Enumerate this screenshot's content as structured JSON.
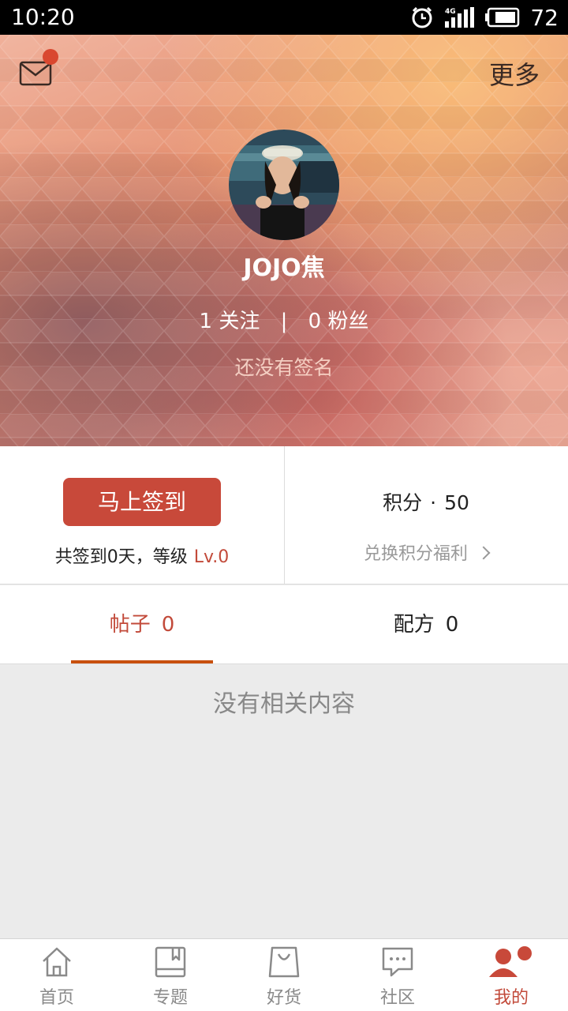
{
  "status_bar": {
    "time": "10:20",
    "network": "4G",
    "battery_level": "72"
  },
  "header": {
    "more_label": "更多",
    "has_unread_mail": true,
    "username": "JOJO焦",
    "following_count": "1",
    "following_label": "关注",
    "separator": "|",
    "followers_count": "0",
    "followers_label": "粉丝",
    "signature": "还没有签名"
  },
  "checkin": {
    "button_label": "马上签到",
    "info_text": "共签到0天，等级",
    "level": "Lv.0"
  },
  "points": {
    "label": "积分",
    "dot": "·",
    "value": "50",
    "redeem_label": "兑换积分福利"
  },
  "tabs": [
    {
      "label": "帖子",
      "count": "0",
      "active": true
    },
    {
      "label": "配方",
      "count": "0",
      "active": false
    }
  ],
  "empty_text": "没有相关内容",
  "bottom_nav": [
    {
      "label": "首页",
      "icon": "home-icon",
      "active": false
    },
    {
      "label": "专题",
      "icon": "book-icon",
      "active": false
    },
    {
      "label": "好货",
      "icon": "shopping-bag-icon",
      "active": false
    },
    {
      "label": "社区",
      "icon": "chat-bubble-icon",
      "active": false
    },
    {
      "label": "我的",
      "icon": "user-icon",
      "active": true
    }
  ],
  "colors": {
    "accent": "#c8493a",
    "accent_text": "#c24a3a",
    "tab_underline": "#c8500e",
    "page_bg": "#ebebeb"
  }
}
